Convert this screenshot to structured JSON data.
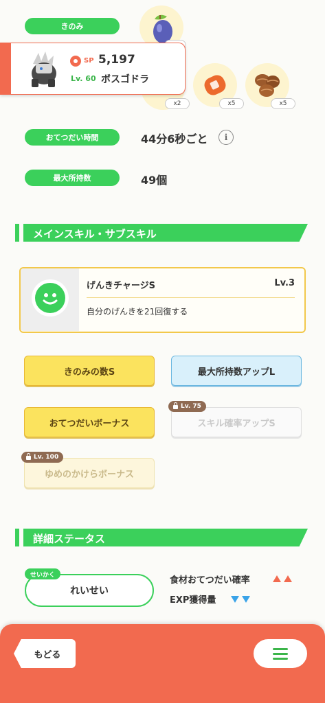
{
  "berry": {
    "label": "きのみ"
  },
  "ingredients": [
    {
      "count": "x2"
    },
    {
      "count": "x5"
    },
    {
      "count": "x5"
    }
  ],
  "pokemon": {
    "sp_label": "SP",
    "sp_value": "5,197",
    "level": "Lv. 60",
    "name": "ボスゴドラ"
  },
  "stats": {
    "help_time_label": "おてつだい時間",
    "help_time_value": "44分6秒ごと",
    "max_carry_label": "最大所持数",
    "max_carry_value": "49個"
  },
  "skills_section": {
    "title": "メインスキル・サブスキル",
    "main_skill": {
      "name": "げんきチャージS",
      "level": "Lv.3",
      "description": "自分のげんきを21回復する"
    },
    "sub_skills": [
      {
        "label": "きのみの数S"
      },
      {
        "label": "最大所持数アップL"
      },
      {
        "label": "おてつだいボーナス"
      },
      {
        "label": "スキル確率アップS",
        "lock": "Lv. 75"
      },
      {
        "label": "ゆめのかけらボーナス",
        "lock": "Lv. 100"
      }
    ]
  },
  "detail_section": {
    "title": "詳細ステータス",
    "nature_tag": "せいかく",
    "nature": "れいせい",
    "up_effect": "食材おてつだい確率",
    "down_effect": "EXP獲得量"
  },
  "bottom": {
    "back": "もどる"
  },
  "colors": {
    "accent": "#3bd05b",
    "bottom_bar": "#f26a4f"
  }
}
